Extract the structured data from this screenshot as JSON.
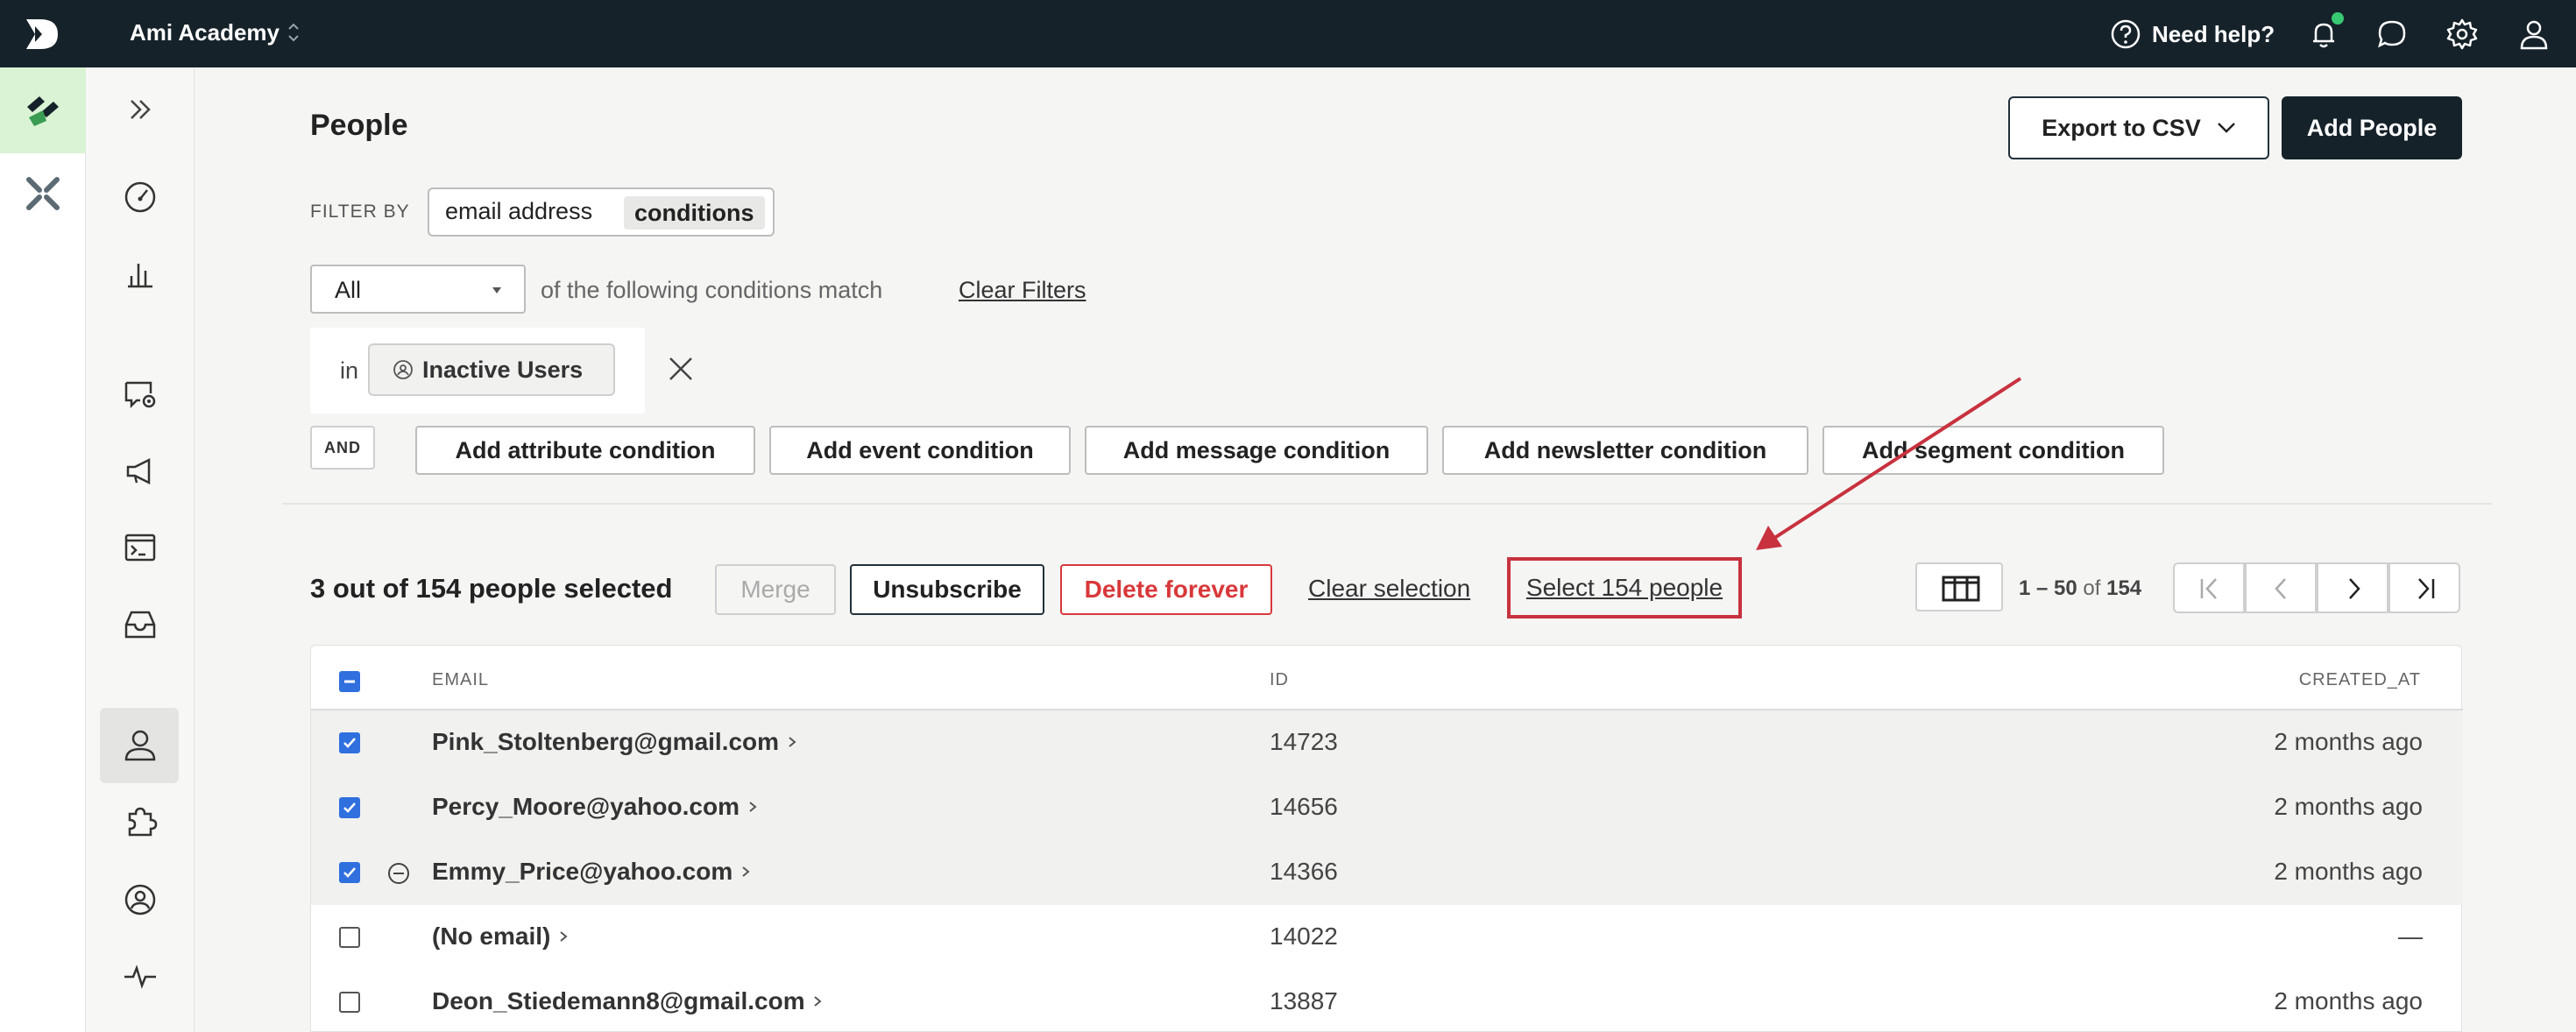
{
  "topbar": {
    "workspace": "Ami Academy",
    "help_label": "Need help?",
    "notification_dot_color": "#37c871"
  },
  "page": {
    "title": "People",
    "export_label": "Export to CSV",
    "add_people_label": "Add People"
  },
  "filters": {
    "filter_by_label": "FILTER BY",
    "email_option": "email address",
    "conditions_option": "conditions",
    "match_value": "All",
    "match_suffix": "of the following conditions match",
    "clear_filters": "Clear Filters",
    "condition_prefix": "in",
    "segment_name": "Inactive Users",
    "and_label": "AND",
    "add_buttons": [
      "Add attribute condition",
      "Add event condition",
      "Add message condition",
      "Add newsletter condition",
      "Add segment condition"
    ]
  },
  "selection": {
    "summary": "3 out of 154 people selected",
    "merge_label": "Merge",
    "unsubscribe_label": "Unsubscribe",
    "delete_label": "Delete forever",
    "clear_selection": "Clear selection",
    "select_all_label": "Select 154 people",
    "highlight_color": "#c8323e"
  },
  "pagination": {
    "range": "1 – 50",
    "of": "of",
    "total": "154"
  },
  "table": {
    "headers": {
      "email": "EMAIL",
      "id": "ID",
      "created_at": "CREATED_AT"
    },
    "rows": [
      {
        "email": "Pink_Stoltenberg@gmail.com",
        "id": "14723",
        "created": "2 months ago",
        "selected": true,
        "unsubscribed": false
      },
      {
        "email": "Percy_Moore@yahoo.com",
        "id": "14656",
        "created": "2 months ago",
        "selected": true,
        "unsubscribed": false
      },
      {
        "email": "Emmy_Price@yahoo.com",
        "id": "14366",
        "created": "2 months ago",
        "selected": true,
        "unsubscribed": true
      },
      {
        "email": "(No email)",
        "id": "14022",
        "created": "—",
        "selected": false,
        "unsubscribed": false
      },
      {
        "email": "Deon_Stiedemann8@gmail.com",
        "id": "13887",
        "created": "2 months ago",
        "selected": false,
        "unsubscribed": false
      }
    ]
  },
  "colors": {
    "topbar": "#16222a",
    "checkbox": "#2f6fde",
    "danger": "#d9383a",
    "rail_active": "#d9f3d4"
  }
}
